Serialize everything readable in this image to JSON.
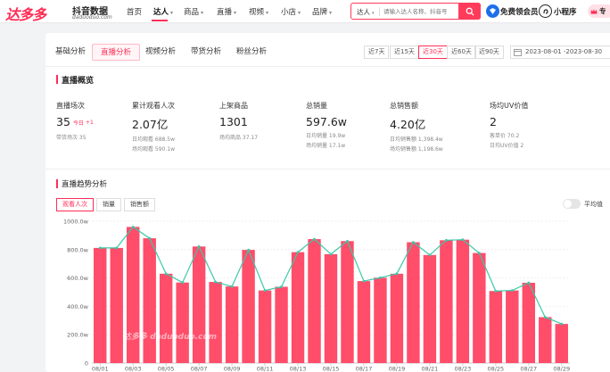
{
  "topbar": {
    "logo_mark": "达多多",
    "logo_name": "抖音数据",
    "logo_domain": "daduoduo.com",
    "nav": [
      {
        "label": "首页",
        "has_menu": false
      },
      {
        "label": "达人",
        "has_menu": true,
        "active": true
      },
      {
        "label": "商品",
        "has_menu": true
      },
      {
        "label": "直播",
        "has_menu": true
      },
      {
        "label": "视频",
        "has_menu": true
      },
      {
        "label": "小店",
        "has_menu": true
      },
      {
        "label": "品牌",
        "has_menu": true
      }
    ],
    "search": {
      "type": "达人",
      "placeholder": "请输入达人名称、抖音号"
    },
    "member": "免费领会员",
    "miniapp": "小程序",
    "extra": "专"
  },
  "tabs": [
    "基础分析",
    "直播分析",
    "视频分析",
    "带货分析",
    "粉丝分析"
  ],
  "active_tab": 1,
  "ranges": [
    "近7天",
    "近15天",
    "近30天",
    "近60天",
    "近90天"
  ],
  "active_range": 2,
  "date_range": "2023-08-01  -2023-08-30",
  "overview": {
    "title": "直播概览",
    "stats": [
      {
        "label": "直播场次",
        "value": "35",
        "badge1": "今日",
        "badge2": "+1",
        "sub1": "带货场次 35",
        "sub2": ""
      },
      {
        "label": "累计观看人次",
        "value": "2.07亿",
        "sub1": "日均观看 688.5w",
        "sub2": "场均观看 590.1w"
      },
      {
        "label": "上架商品",
        "value": "1301",
        "sub1": "场均商品 37.17",
        "sub2": ""
      },
      {
        "label": "总销量",
        "value": "597.6w",
        "sub1": "日均销量 19.9w",
        "sub2": "场均销量 17.1w"
      },
      {
        "label": "总销售额",
        "value": "4.20亿",
        "sub1": "日均销售额 1,398.4w",
        "sub2": "场均销售额 1,198.6w"
      },
      {
        "label": "场均UV价值",
        "value": "2",
        "sub1": "客单价 70.2",
        "sub2": "日均UV价值 2"
      }
    ]
  },
  "trend": {
    "title": "直播趋势分析",
    "metric_tabs": [
      "观看人次",
      "销量",
      "销售额"
    ],
    "active_metric": 0,
    "toggle_label": "平均值",
    "watermark": "达多多 daduoduo.com"
  },
  "colors": {
    "accent": "#ff2d55",
    "bar": "#ff4d6a",
    "line": "#3cc8a8"
  },
  "chart_data": {
    "type": "bar",
    "ylim": [
      0,
      1000
    ],
    "y_ticks": [
      "0",
      "200.0w",
      "400.0w",
      "600.0w",
      "800.0w",
      "1000.0w"
    ],
    "x_tick_labels": [
      "08/01",
      "08/03",
      "08/05",
      "08/07",
      "08/09",
      "08/11",
      "08/13",
      "08/15",
      "08/17",
      "08/19",
      "08/21",
      "08/23",
      "08/25",
      "08/27",
      "08/29"
    ],
    "grid": true,
    "series": [
      {
        "values": [
          812,
          812,
          960,
          880,
          630,
          568,
          822,
          572,
          540,
          798,
          512,
          538,
          782,
          874,
          768,
          860,
          578,
          602,
          630,
          852,
          762,
          866,
          870,
          776,
          508,
          512,
          566,
          324,
          276
        ]
      }
    ],
    "line_overlay": "trend line through bar tops"
  }
}
